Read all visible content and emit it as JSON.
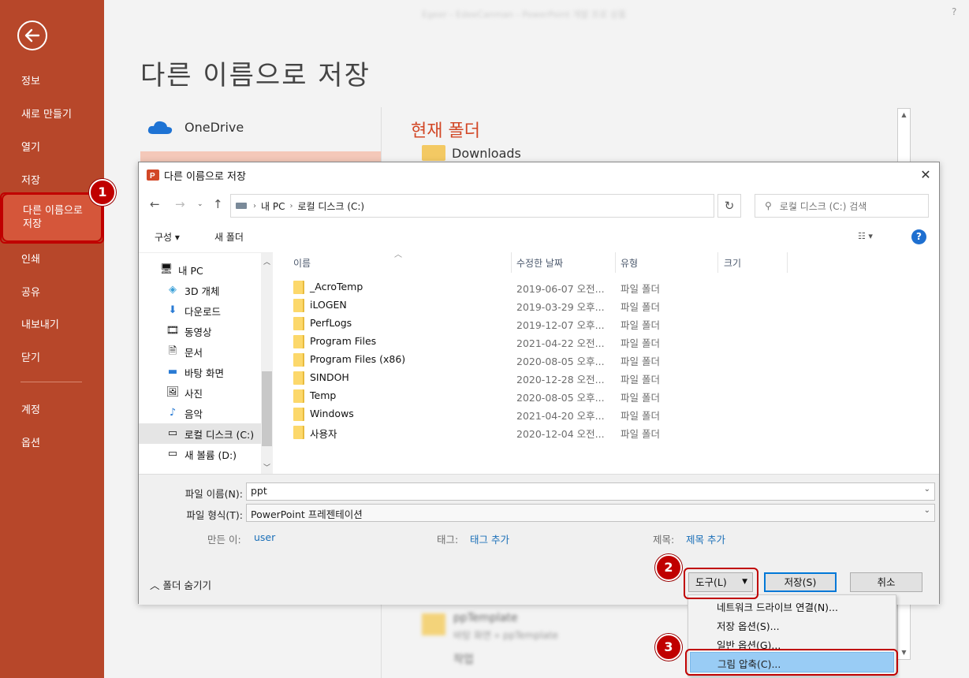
{
  "window": {
    "blurred_title": "Egeer - EdeeCanman - PowerPoint 개발 프로 상품",
    "help": "?"
  },
  "sidebar": {
    "items": [
      "정보",
      "새로 만들기",
      "열기",
      "저장",
      "다른 이름으로 저장",
      "인쇄",
      "공유",
      "내보내기",
      "닫기",
      "계정",
      "옵션"
    ],
    "active_label_line1": "다른 이름으로",
    "active_label_line2": "저장"
  },
  "backstage": {
    "title": "다른 이름으로 저장",
    "onedrive_label": "OneDrive",
    "current_folder_heading": "현재 폴더",
    "downloads_label": "Downloads",
    "blurred_item1": "ppTemplate",
    "blurred_item1_sub": "바탕 화면 » ppTemplate",
    "blurred_item2": "작업"
  },
  "dialog": {
    "title": "다른 이름으로 저장",
    "address": [
      "내 PC",
      "로컬 디스크 (C:)"
    ],
    "search_placeholder": "로컬 디스크 (C:) 검색",
    "toolbar": {
      "organize": "구성 ▾",
      "new_folder": "새 폴더"
    },
    "tree": [
      "내 PC",
      "3D 개체",
      "다운로드",
      "동영상",
      "문서",
      "바탕 화면",
      "사진",
      "음악",
      "로컬 디스크 (C:)",
      "새 볼륨 (D:)"
    ],
    "columns": {
      "name": "이름",
      "modified": "수정한 날짜",
      "type": "유형",
      "size": "크기"
    },
    "files": [
      {
        "name": "_AcroTemp",
        "date": "2019-06-07 오전...",
        "type": "파일 폴더"
      },
      {
        "name": "iLOGEN",
        "date": "2019-03-29 오후...",
        "type": "파일 폴더"
      },
      {
        "name": "PerfLogs",
        "date": "2019-12-07 오후...",
        "type": "파일 폴더"
      },
      {
        "name": "Program Files",
        "date": "2021-04-22 오전...",
        "type": "파일 폴더"
      },
      {
        "name": "Program Files (x86)",
        "date": "2020-08-05 오후...",
        "type": "파일 폴더"
      },
      {
        "name": "SINDOH",
        "date": "2020-12-28 오전...",
        "type": "파일 폴더"
      },
      {
        "name": "Temp",
        "date": "2020-08-05 오후...",
        "type": "파일 폴더"
      },
      {
        "name": "Windows",
        "date": "2021-04-20 오후...",
        "type": "파일 폴더"
      },
      {
        "name": "사용자",
        "date": "2020-12-04 오전...",
        "type": "파일 폴더"
      }
    ],
    "form": {
      "filename_label": "파일 이름(N):",
      "filename_value": "ppt",
      "filetype_label": "파일 형식(T):",
      "filetype_value": "PowerPoint 프레젠테이션",
      "author_label": "만든 이:",
      "author_value": "user",
      "tags_label": "태그:",
      "tags_value": "태그 추가",
      "title_label": "제목:",
      "title_value": "제목 추가",
      "hide_folders": "폴더 숨기기"
    },
    "buttons": {
      "tools": "도구(L)",
      "save": "저장(S)",
      "cancel": "취소"
    }
  },
  "tools_menu": [
    "네트워크 드라이브 연결(N)...",
    "저장 옵션(S)...",
    "일반 옵션(G)...",
    "그림 압축(C)..."
  ],
  "callouts": [
    "1",
    "2",
    "3"
  ],
  "colors": {
    "accent": "#b7472a",
    "highlight": "#c00000",
    "link": "#1a6fb8",
    "selected_menu": "#99ccf5"
  }
}
